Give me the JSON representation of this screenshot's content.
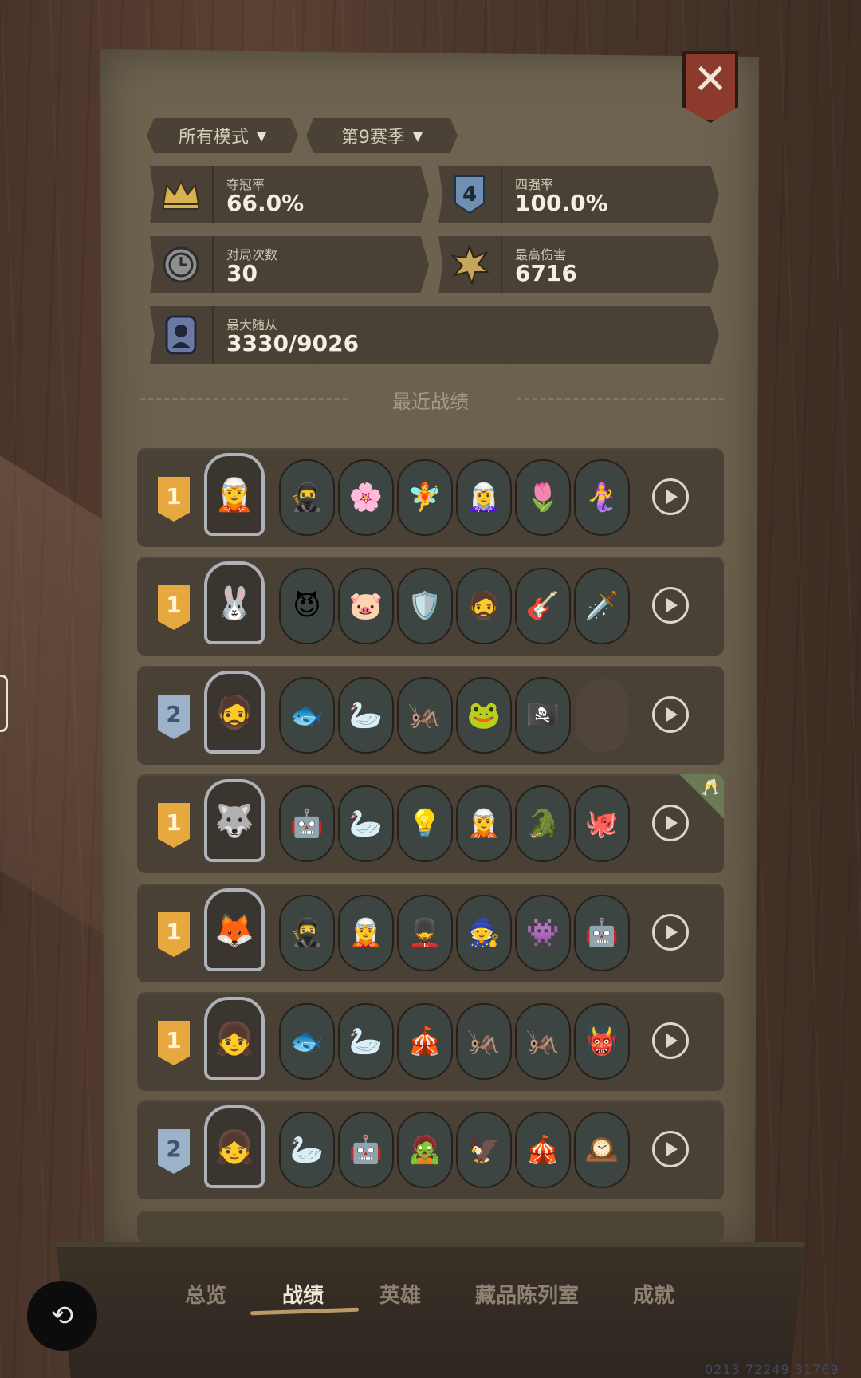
{
  "filters": {
    "mode": "所有模式",
    "season": "第9赛季"
  },
  "stats": {
    "win_rate": {
      "label": "夺冠率",
      "value": "66.0%"
    },
    "top4_rate": {
      "label": "四强率",
      "value": "100.0%"
    },
    "games": {
      "label": "对局次数",
      "value": "30"
    },
    "max_damage": {
      "label": "最高伤害",
      "value": "6716"
    },
    "max_minions": {
      "label": "最大随从",
      "value": "3330/9026"
    }
  },
  "section_title": "最近战绩",
  "matches": [
    {
      "rank": "1",
      "rank_color": "gold",
      "hero_icon": "🧝",
      "units": [
        "🥷",
        "🌸",
        "🧚",
        "🧝‍♀️",
        "🌷",
        "🧜‍♀️"
      ]
    },
    {
      "rank": "1",
      "rank_color": "gold",
      "hero_icon": "🐰",
      "units": [
        "😈",
        "🐷",
        "🛡️",
        "🧔",
        "🎸",
        "🗡️"
      ]
    },
    {
      "rank": "2",
      "rank_color": "blue",
      "hero_icon": "🧔",
      "units": [
        "🐟",
        "🦢",
        "🦗",
        "🐸",
        "🏴‍☠️",
        ""
      ]
    },
    {
      "rank": "1",
      "rank_color": "gold",
      "hero_icon": "🐺",
      "units": [
        "🤖",
        "🦢",
        "💡",
        "🧝",
        "🐊",
        "🐙"
      ],
      "has_corner_badge": true
    },
    {
      "rank": "1",
      "rank_color": "gold",
      "hero_icon": "🦊",
      "units": [
        "🥷",
        "🧝",
        "💂",
        "🧙",
        "👾",
        "🤖"
      ]
    },
    {
      "rank": "1",
      "rank_color": "gold",
      "hero_icon": "👧",
      "units": [
        "🐟",
        "🦢",
        "🎪",
        "🦗",
        "🦗",
        "👹"
      ]
    },
    {
      "rank": "2",
      "rank_color": "blue",
      "hero_icon": "👧",
      "units": [
        "🦢",
        "🤖",
        "🧟",
        "🦅",
        "🎪",
        "🕰️"
      ]
    }
  ],
  "tabs": [
    "总览",
    "战绩",
    "英雄",
    "藏品陈列室",
    "成就"
  ],
  "active_tab": "战绩",
  "watermark": "0213 72249 31769",
  "colors": {
    "gold_rank": "#e6a83f",
    "blue_rank": "#9cb2c9",
    "close_red": "#8c3a2c"
  }
}
